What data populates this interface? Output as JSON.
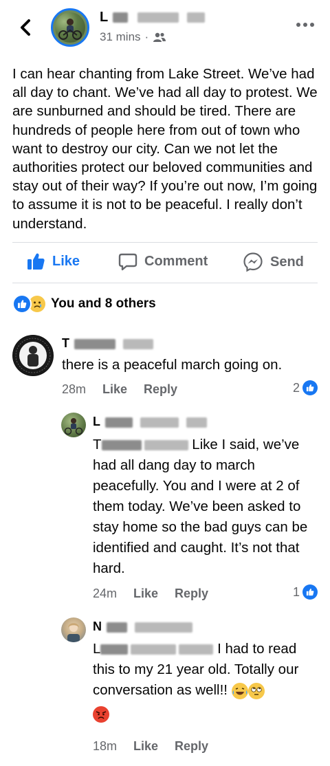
{
  "header": {
    "author_initial": "L",
    "time": "31 mins",
    "separator": "·"
  },
  "post": {
    "text": "I can hear chanting from Lake Street. We’ve had all day to chant. We’ve had all day to protest. We are sunburned and should be tired. There are hundreds of people here from out of town who want to destroy our city. Can we not let the authorities protect our beloved communities and stay out of their way? If you’re out now, I’m going to assume it is not to be peaceful. I really don’t understand."
  },
  "actions": {
    "like": "Like",
    "comment": "Comment",
    "send": "Send"
  },
  "reactions": {
    "summary": "You and 8 others"
  },
  "comments": [
    {
      "initial": "T",
      "text": "there is a peaceful march going on.",
      "time": "28m",
      "like": "Like",
      "reply": "Reply",
      "reaction_count": "2",
      "avatar_ring_text": "FOUR TIMES ANTIFASCIST · ALWAYS ANTIFASCIST"
    },
    {
      "initial": "L",
      "mention_initial": "T",
      "text_line1": " Like I said, we’ve",
      "text_rest": "had all dang day to march peacefully. You and I were at 2 of them today. We’ve been asked to stay home so the bad guys can be identified and caught. It’s not that hard.",
      "time": "24m",
      "like": "Like",
      "reply": "Reply",
      "reaction_count": "1"
    },
    {
      "initial": "N",
      "mention_initial": "L",
      "text_line1": " I had to read",
      "text_rest": "this to my 21 year old. Totally our conversation as well!!",
      "time": "18m",
      "like": "Like",
      "reply": "Reply"
    }
  ],
  "icons": {
    "back": "chevron-left-icon",
    "privacy": "friends-icon",
    "more": "more-horizontal-icon",
    "like": "thumbs-up-icon",
    "comment": "comment-bubble-icon",
    "send": "messenger-icon",
    "laugh_emoji": "tears-of-joy-emoji",
    "eyeroll_emoji": "eye-roll-emoji",
    "angry_emoji": "angry-emoji"
  },
  "colors": {
    "accent": "#1877f2",
    "secondary_text": "#65676b",
    "primary_text": "#050505"
  }
}
